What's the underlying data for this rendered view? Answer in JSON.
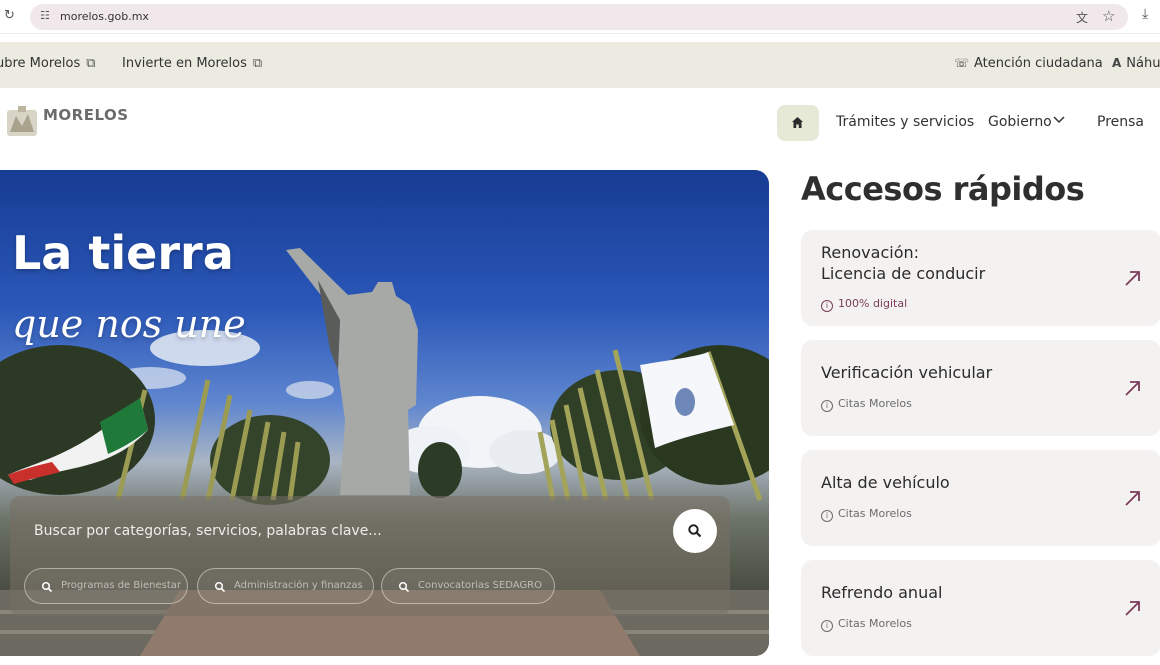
{
  "browser": {
    "url": "morelos.gob.mx"
  },
  "top_strip": {
    "sobre": "ubre Morelos",
    "invierte": "Invierte en Morelos",
    "atencion": "Atención ciudadana",
    "nahuatl": "Náhu"
  },
  "header": {
    "logo_title": "MORELOS",
    "nav": {
      "tramites": "Trámites y servicios",
      "gobierno": "Gobierno",
      "prensa": "Prensa"
    }
  },
  "hero": {
    "title": "La tierra",
    "subtitle": "que nos une",
    "search_placeholder": "Buscar por categorías, servicios, palabras clave...",
    "chips": [
      "Programas de Bienestar",
      "Administración y finanzas",
      "Convocatorias SEDAGRO"
    ]
  },
  "quick_access": {
    "title": "Accesos rápidos",
    "cards": [
      {
        "title": "Renovación:\nLicencia de conducir",
        "tag": "100% digital"
      },
      {
        "title": "Verificación vehicular",
        "tag": "Citas Morelos"
      },
      {
        "title": "Alta de vehículo",
        "tag": "Citas Morelos"
      },
      {
        "title": "Refrendo anual",
        "tag": "Citas Morelos"
      }
    ]
  },
  "colors": {
    "accent": "#7b3b5a",
    "home_bg": "#e5e9d6",
    "strip_bg": "#ebebe1",
    "card_bg": "#f4f2f1"
  }
}
